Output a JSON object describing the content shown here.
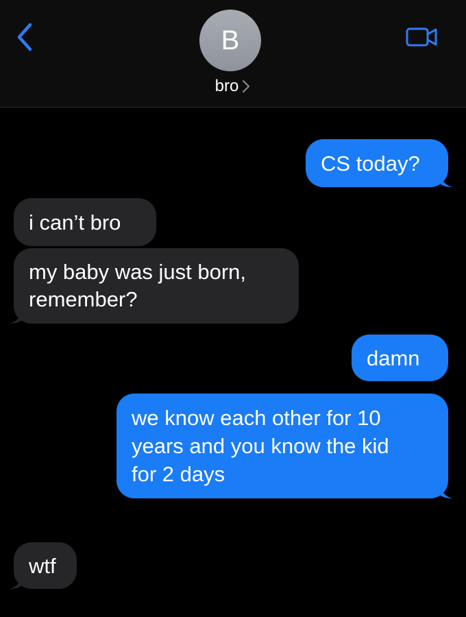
{
  "colors": {
    "background": "#000000",
    "header": "#0d0d0d",
    "outgoing_bubble": "#1a7cf7",
    "incoming_bubble": "#262628",
    "accent": "#2d7cf6"
  },
  "header": {
    "back_icon": "chevron-left-icon",
    "avatar_initial": "B",
    "contact_name": "bro",
    "contact_chevron": ">",
    "video_icon": "video-camera-icon"
  },
  "messages": [
    {
      "direction": "out",
      "text": "CS today?"
    },
    {
      "direction": "in",
      "text": "i can’t bro"
    },
    {
      "direction": "in",
      "text": "my baby was just born,\nremember?"
    },
    {
      "direction": "out",
      "text": "damn"
    },
    {
      "direction": "out",
      "text": "we know each other for 10\nyears and you know the kid\nfor 2 days"
    },
    {
      "direction": "in",
      "text": "wtf"
    }
  ]
}
